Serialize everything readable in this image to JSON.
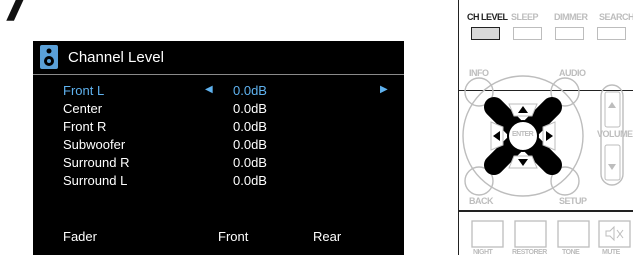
{
  "step_number": "7",
  "screen": {
    "title": "Channel Level",
    "rows": [
      {
        "label": "Front L",
        "value": "0.0dB",
        "selected": true
      },
      {
        "label": "Center",
        "value": "0.0dB",
        "selected": false
      },
      {
        "label": "Front R",
        "value": "0.0dB",
        "selected": false
      },
      {
        "label": "Subwoofer",
        "value": "0.0dB",
        "selected": false
      },
      {
        "label": "Surround R",
        "value": "0.0dB",
        "selected": false
      },
      {
        "label": "Surround L",
        "value": "0.0dB",
        "selected": false
      }
    ],
    "fader": {
      "label": "Fader",
      "front": "Front",
      "rear": "Rear"
    }
  },
  "remote": {
    "top_buttons": [
      "CH LEVEL",
      "SLEEP",
      "DIMMER",
      "SEARCH"
    ],
    "active_button": "CH LEVEL",
    "labels": {
      "info": "INFO",
      "audio": "AUDIO",
      "back": "BACK",
      "setup": "SETUP",
      "volume": "VOLUME",
      "enter": "ENTER"
    },
    "bottom_labels": [
      "NIGHT",
      "RESTORER",
      "TONE",
      "MUTE"
    ]
  },
  "colors": {
    "selected_row": "#5fb2ef",
    "screen_bg": "#000000",
    "speaker_icon": "#5aa0d8"
  }
}
